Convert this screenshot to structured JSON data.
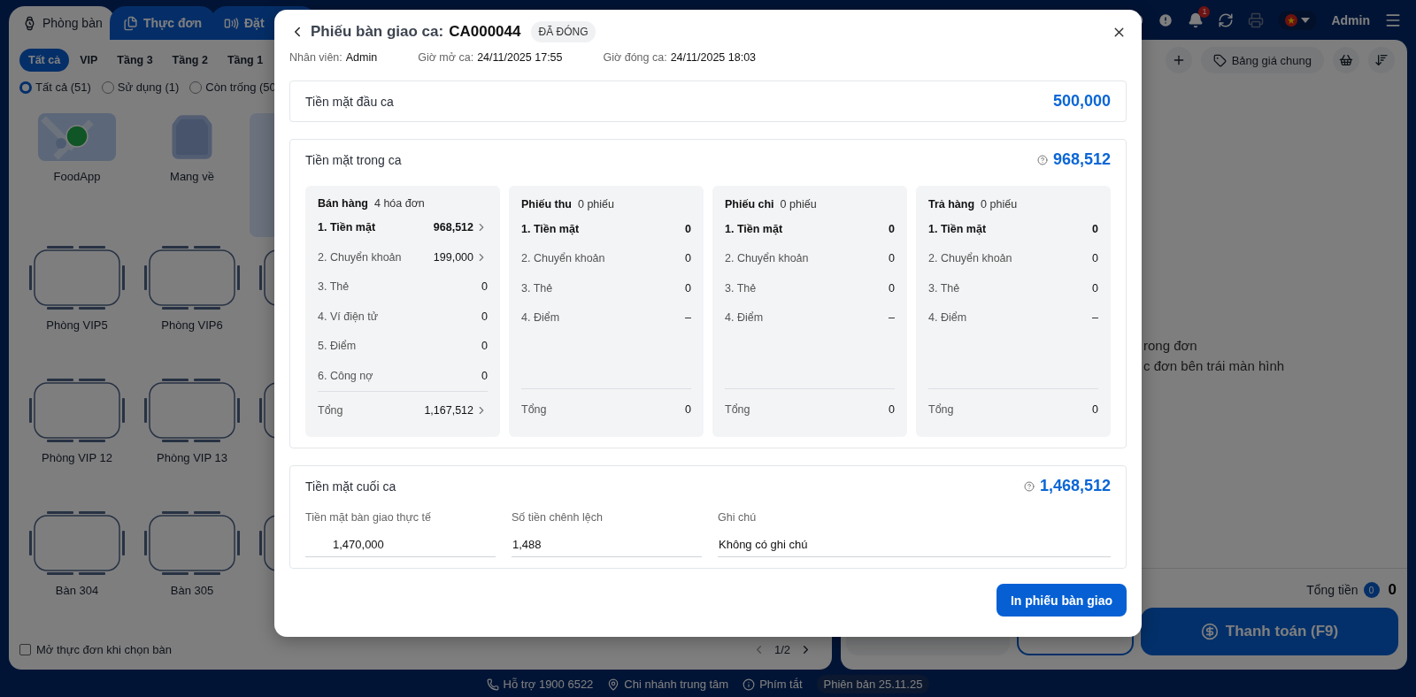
{
  "header": {
    "tabs": [
      {
        "label": "Phòng bàn",
        "selected": true
      },
      {
        "label": "Thực đơn",
        "selected": false
      },
      {
        "label": "Đặt",
        "selected": false
      }
    ],
    "notifications": "1",
    "user": "Admin"
  },
  "left_panel": {
    "areas": [
      {
        "label": "Tất cả",
        "selected": true
      },
      {
        "label": "VIP",
        "selected": false
      },
      {
        "label": "Tầng 3",
        "selected": false
      },
      {
        "label": "Tầng 2",
        "selected": false
      },
      {
        "label": "Tầng 1",
        "selected": false
      }
    ],
    "filters": [
      {
        "label": "Tất cả (51)",
        "selected": true
      },
      {
        "label": "Sử dụng (1)",
        "selected": false
      },
      {
        "label": "Còn trống (50",
        "selected": false
      }
    ],
    "tables": [
      {
        "kind": "foodapp",
        "label": "FoodApp"
      },
      {
        "kind": "takeaway",
        "label": "Mang về"
      },
      {
        "kind": "highlight"
      },
      {
        "kind": "table",
        "label": "Phòng VIP5"
      },
      {
        "kind": "table",
        "label": "Phòng VIP6"
      },
      {
        "kind": "table"
      },
      {
        "kind": "table",
        "label": "Phòng VIP 12"
      },
      {
        "kind": "table",
        "label": "Phòng VIP 13"
      },
      {
        "kind": "table"
      },
      {
        "kind": "table",
        "label": "Bàn 304"
      },
      {
        "kind": "table",
        "label": "Bàn 305"
      },
      {
        "kind": "table"
      }
    ],
    "open_menu_checkbox": {
      "label": "Mở thực đơn khi chọn bàn",
      "checked": false
    },
    "page": "1/2"
  },
  "right_panel": {
    "price_list": "Bảng giá chung",
    "empty_message": [
      "rong đơn",
      "c đơn bên trái màn hình"
    ],
    "total_label": "Tổng tiền",
    "item_count": "0",
    "total": "0",
    "pay_button": "Thanh toán (F9)"
  },
  "footer": [
    {
      "kind": "link",
      "label": "Hỗ trợ 1900 6522"
    },
    {
      "kind": "link",
      "label": "Chi nhánh trung tâm"
    },
    {
      "kind": "link",
      "label": "Phím tắt"
    },
    {
      "kind": "version",
      "label": "Phiên bản 25.11.25"
    }
  ],
  "modal": {
    "title": "Phiếu bàn giao ca:",
    "code": "CA000044",
    "status": "ĐÃ ĐÓNG",
    "info": [
      {
        "label": "Nhân viên:",
        "value": "Admin"
      },
      {
        "label": "Giờ mở ca:",
        "value": "24/11/2025 17:55"
      },
      {
        "label": "Giờ đóng ca:",
        "value": "24/11/2025 18:03"
      }
    ],
    "opening_cash": {
      "label": "Tiền mặt đầu ca",
      "amount": "500,000"
    },
    "shift_cash": {
      "label": "Tiền mặt trong ca",
      "amount": "968,512",
      "groups": [
        {
          "name": "Bán hàng",
          "count": "4 hóa đơn",
          "rows": [
            {
              "label": "1. Tiền mặt",
              "value": "968,512",
              "bold": true,
              "arrow": true
            },
            {
              "label": "2. Chuyển khoản",
              "value": "199,000",
              "bold": false,
              "arrow": true
            },
            {
              "label": "3. Thẻ",
              "value": "0",
              "bold": false,
              "arrow": false
            },
            {
              "label": "4. Ví điện tử",
              "value": "0",
              "bold": false,
              "arrow": false
            },
            {
              "label": "5. Điểm",
              "value": "0",
              "bold": false,
              "arrow": false
            },
            {
              "label": "6. Công nợ",
              "value": "0",
              "bold": false,
              "arrow": false
            }
          ],
          "total": {
            "label": "Tổng",
            "value": "1,167,512",
            "arrow": true
          }
        },
        {
          "name": "Phiếu thu",
          "count": "0 phiếu",
          "rows": [
            {
              "label": "1. Tiền mặt",
              "value": "0",
              "bold": true,
              "arrow": false
            },
            {
              "label": "2. Chuyển khoản",
              "value": "0",
              "bold": false,
              "arrow": false
            },
            {
              "label": "3. Thẻ",
              "value": "0",
              "bold": false,
              "arrow": false
            },
            {
              "label": "4. Điểm",
              "value": "–",
              "bold": false,
              "arrow": false
            }
          ],
          "total": {
            "label": "Tổng",
            "value": "0",
            "arrow": false
          }
        },
        {
          "name": "Phiếu chi",
          "count": "0 phiếu",
          "rows": [
            {
              "label": "1. Tiền mặt",
              "value": "0",
              "bold": true,
              "arrow": false
            },
            {
              "label": "2. Chuyển khoản",
              "value": "0",
              "bold": false,
              "arrow": false
            },
            {
              "label": "3. Thẻ",
              "value": "0",
              "bold": false,
              "arrow": false
            },
            {
              "label": "4. Điểm",
              "value": "–",
              "bold": false,
              "arrow": false
            }
          ],
          "total": {
            "label": "Tổng",
            "value": "0",
            "arrow": false
          }
        },
        {
          "name": "Trả hàng",
          "count": "0 phiếu",
          "rows": [
            {
              "label": "1. Tiền mặt",
              "value": "0",
              "bold": true,
              "arrow": false
            },
            {
              "label": "2. Chuyển khoản",
              "value": "0",
              "bold": false,
              "arrow": false
            },
            {
              "label": "3. Thẻ",
              "value": "0",
              "bold": false,
              "arrow": false
            },
            {
              "label": "4. Điểm",
              "value": "–",
              "bold": false,
              "arrow": false
            }
          ],
          "total": {
            "label": "Tổng",
            "value": "0",
            "arrow": false
          }
        }
      ]
    },
    "closing_cash": {
      "label": "Tiền mặt cuối ca",
      "amount": "1,468,512",
      "fields": [
        {
          "kind": "money",
          "label": "Tiền mặt bàn giao thực tế",
          "value": "1,470,000"
        },
        {
          "kind": "text",
          "label": "Số tiền chênh lệch",
          "value": "1,488"
        },
        {
          "kind": "text",
          "label": "Ghi chú",
          "value": "Không có ghi chú"
        }
      ]
    },
    "print_button": "In phiếu bàn giao"
  }
}
